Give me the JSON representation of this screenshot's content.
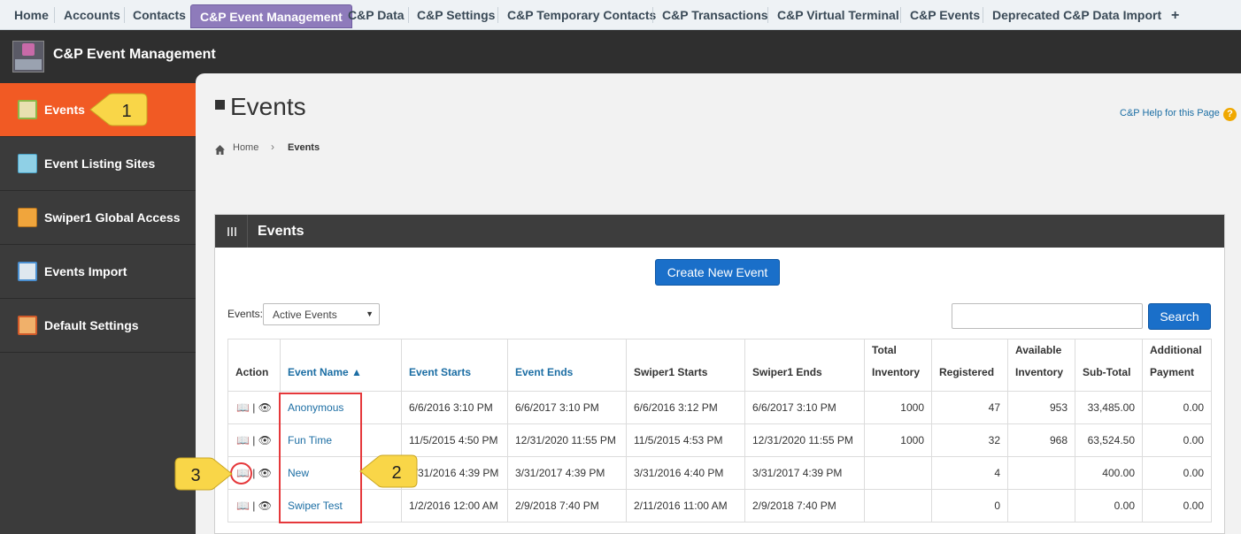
{
  "top_tabs": [
    {
      "label": "Home",
      "active": false
    },
    {
      "label": "Accounts",
      "active": false
    },
    {
      "label": "Contacts",
      "active": false
    },
    {
      "label": "C&P Event Management",
      "active": true
    },
    {
      "label": "C&P Data",
      "active": false
    },
    {
      "label": "C&P Settings",
      "active": false
    },
    {
      "label": "C&P Temporary Contacts",
      "active": false
    },
    {
      "label": "C&P Transactions",
      "active": false
    },
    {
      "label": "C&P Virtual Terminal",
      "active": false
    },
    {
      "label": "C&P Events",
      "active": false
    },
    {
      "label": "Deprecated C&P Data Import",
      "active": false
    },
    {
      "label": "+",
      "active": false
    }
  ],
  "app": {
    "title": "C&P Event Management",
    "logo_icon": "event-crowd-icon"
  },
  "sidebar": {
    "items": [
      {
        "label": "Events",
        "active": true,
        "icon": "calendar-icon"
      },
      {
        "label": "Event Listing Sites",
        "active": false,
        "icon": "list-document-icon"
      },
      {
        "label": "Swiper1 Global Access",
        "active": false,
        "icon": "card-swiper-icon"
      },
      {
        "label": "Events Import",
        "active": false,
        "icon": "calendar-import-icon"
      },
      {
        "label": "Default Settings",
        "active": false,
        "icon": "calendar-settings-icon"
      }
    ]
  },
  "page": {
    "title": "Events",
    "help_link": "C&P Help for this Page",
    "help_icon": "?",
    "breadcrumb": {
      "home": "Home",
      "separator": "›",
      "current": "Events"
    }
  },
  "panel": {
    "title": "Events",
    "create_button": "Create New Event",
    "filter_label": "Events:",
    "filter_value": "Active Events",
    "search_button": "Search",
    "search_value": ""
  },
  "table": {
    "headers": {
      "action": "Action",
      "name": "Event Name ▲",
      "starts": "Event Starts",
      "ends": "Event Ends",
      "swiper_starts": "Swiper1 Starts",
      "swiper_ends": "Swiper1 Ends",
      "total_inventory_1": "Total",
      "total_inventory_2": "Inventory",
      "registered": "Registered",
      "available_1": "Available",
      "available_2": "Inventory",
      "subtotal": "Sub-Total",
      "additional_1": "Additional",
      "additional_2": "Payment"
    },
    "action_sep": "|",
    "rows": [
      {
        "name": "Anonymous",
        "starts": "6/6/2016 3:10 PM",
        "ends": "6/6/2017 3:10 PM",
        "swiper_starts": "6/6/2016 3:12 PM",
        "swiper_ends": "6/6/2017 3:10 PM",
        "total": "1000",
        "registered": "47",
        "available": "953",
        "subtotal": "33,485.00",
        "additional": "0.00"
      },
      {
        "name": "Fun Time",
        "starts": "11/5/2015 4:50 PM",
        "ends": "12/31/2020 11:55 PM",
        "swiper_starts": "11/5/2015 4:53 PM",
        "swiper_ends": "12/31/2020 11:55 PM",
        "total": "1000",
        "registered": "32",
        "available": "968",
        "subtotal": "63,524.50",
        "additional": "0.00"
      },
      {
        "name": "New",
        "starts": "3/31/2016 4:39 PM",
        "ends": "3/31/2017 4:39 PM",
        "swiper_starts": "3/31/2016 4:40 PM",
        "swiper_ends": "3/31/2017 4:39 PM",
        "total": "",
        "registered": "4",
        "available": "",
        "subtotal": "400.00",
        "additional": "0.00"
      },
      {
        "name": "Swiper Test",
        "starts": "1/2/2016 12:00 AM",
        "ends": "2/9/2018 7:40 PM",
        "swiper_starts": "2/11/2016 11:00 AM",
        "swiper_ends": "2/9/2018 7:40 PM",
        "total": "",
        "registered": "0",
        "available": "",
        "subtotal": "0.00",
        "additional": "0.00"
      }
    ]
  },
  "callouts": [
    {
      "label": "1",
      "target": "sidebar events item"
    },
    {
      "label": "2",
      "target": "event name column"
    },
    {
      "label": "3",
      "target": "row action book icon"
    }
  ],
  "colors": {
    "accent": "#f15a24",
    "tab_active": "#8e7bbb",
    "link": "#1c6ea4",
    "button": "#1a6fc9",
    "callout_fill": "#f9d648",
    "highlight": "#e5383b"
  }
}
